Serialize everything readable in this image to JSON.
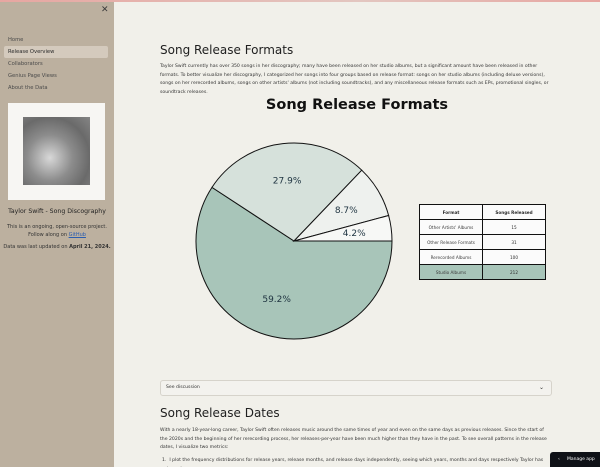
{
  "sidebar": {
    "nav": [
      "Home",
      "Release Overview",
      "Collaborators",
      "Genius Page Views",
      "About the Data"
    ],
    "active_index": 1,
    "profile_title": "Taylor Swift - Song Discography",
    "project_line": "This is an ongoing, open-source project.",
    "follow_prefix": "Follow along on",
    "follow_link": "GitHub",
    "updated_prefix": "Data was last updated on",
    "updated_date": "April 21, 2024."
  },
  "main": {
    "section1_title": "Song Release Formats",
    "section1_text": "Taylor Swift currently has over 350 songs in her discography; many have been released on her studio albums, but a significant amount have been released in other formats. To better visualize her discography, I categorized her songs into four groups based on release format: songs on her studio albums (including deluxe versions), songs on her rerecorded albums, songs on other artists' albums (not including soundtracks), and any miscellaneous release formats such as EPs, promotional singles, or soundtrack releases.",
    "expander_label": "See discussion",
    "section2_title": "Song Release Dates",
    "section2_text": "With a nearly 18-year-long career, Taylor Swift often releases music around the same times of year and even on the same days as previous releases. Since the start of the 2020s and the beginning of her rerecording process, her releases-per-year have been much higher than they have in the past. To see overall patterns in the release dates, I visualize two metrics:",
    "list_item_1": "I plot the frequency distributions for release years, release months, and release days independently, seeing which years, months and days respectively Taylor has released"
  },
  "chart_data": {
    "type": "pie",
    "title": "Song Release Formats",
    "slices": [
      {
        "label": "Studio Albums",
        "value": 212,
        "pct": "59.2%",
        "color": "#a8c5b9"
      },
      {
        "label": "Rerecorded Albums",
        "value": 100,
        "pct": "27.9%",
        "color": "#d6e1db"
      },
      {
        "label": "Other Release Formats",
        "value": 31,
        "pct": "8.7%",
        "color": "#eef1ee"
      },
      {
        "label": "Other Artists' Albums",
        "value": 15,
        "pct": "4.2%",
        "color": "#f7f8f6"
      }
    ],
    "table_headers": [
      "Format",
      "Songs Released"
    ],
    "table_rows": [
      {
        "format": "Other Artists' Albums",
        "count": "15"
      },
      {
        "format": "Other Release Formats",
        "count": "31"
      },
      {
        "format": "Rerecorded Albums",
        "count": "100"
      },
      {
        "format": "Studio Albums",
        "count": "212"
      }
    ]
  },
  "footer": {
    "manage_label": "Manage app"
  }
}
